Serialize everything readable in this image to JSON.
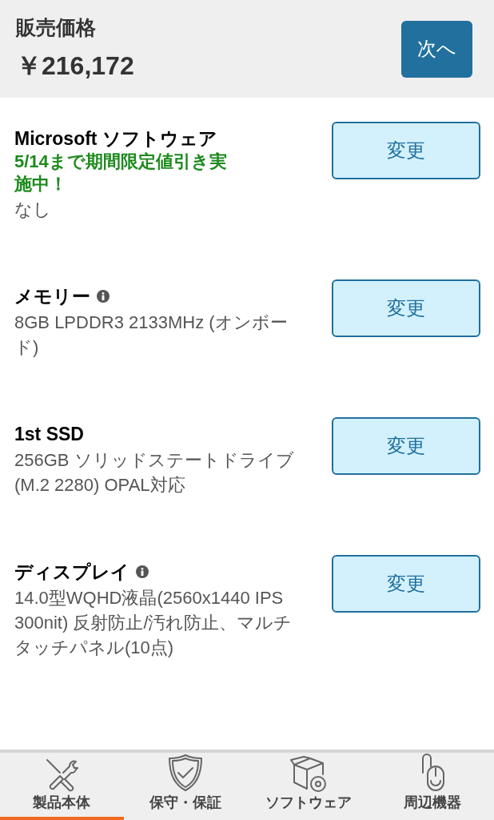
{
  "header": {
    "label": "販売価格",
    "price": "￥216,172",
    "next_button": "次へ"
  },
  "options": [
    {
      "title": "Microsoft ソフトウェア",
      "info": false,
      "promo": "5/14まで期間限定値引き実施中！",
      "value": "なし",
      "button": "変更"
    },
    {
      "title": "メモリー",
      "info": true,
      "value": "8GB LPDDR3 2133MHz (オンボード)",
      "button": "変更"
    },
    {
      "title": "1st SSD",
      "info": false,
      "value": "256GB ソリッドステートドライブ (M.2 2280) OPAL対応",
      "button": "変更"
    },
    {
      "title": "ディスプレイ",
      "info": true,
      "value": "14.0型WQHD液晶(2560x1440 IPS 300nit) 反射防止/汚れ防止、マルチタッチパネル(10点)",
      "button": "変更"
    }
  ],
  "bottom_tabs": [
    {
      "label": "製品本体",
      "selected": true
    },
    {
      "label": "保守・保証",
      "selected": false
    },
    {
      "label": "ソフトウェア",
      "selected": false
    },
    {
      "label": "周辺機器",
      "selected": false
    }
  ]
}
